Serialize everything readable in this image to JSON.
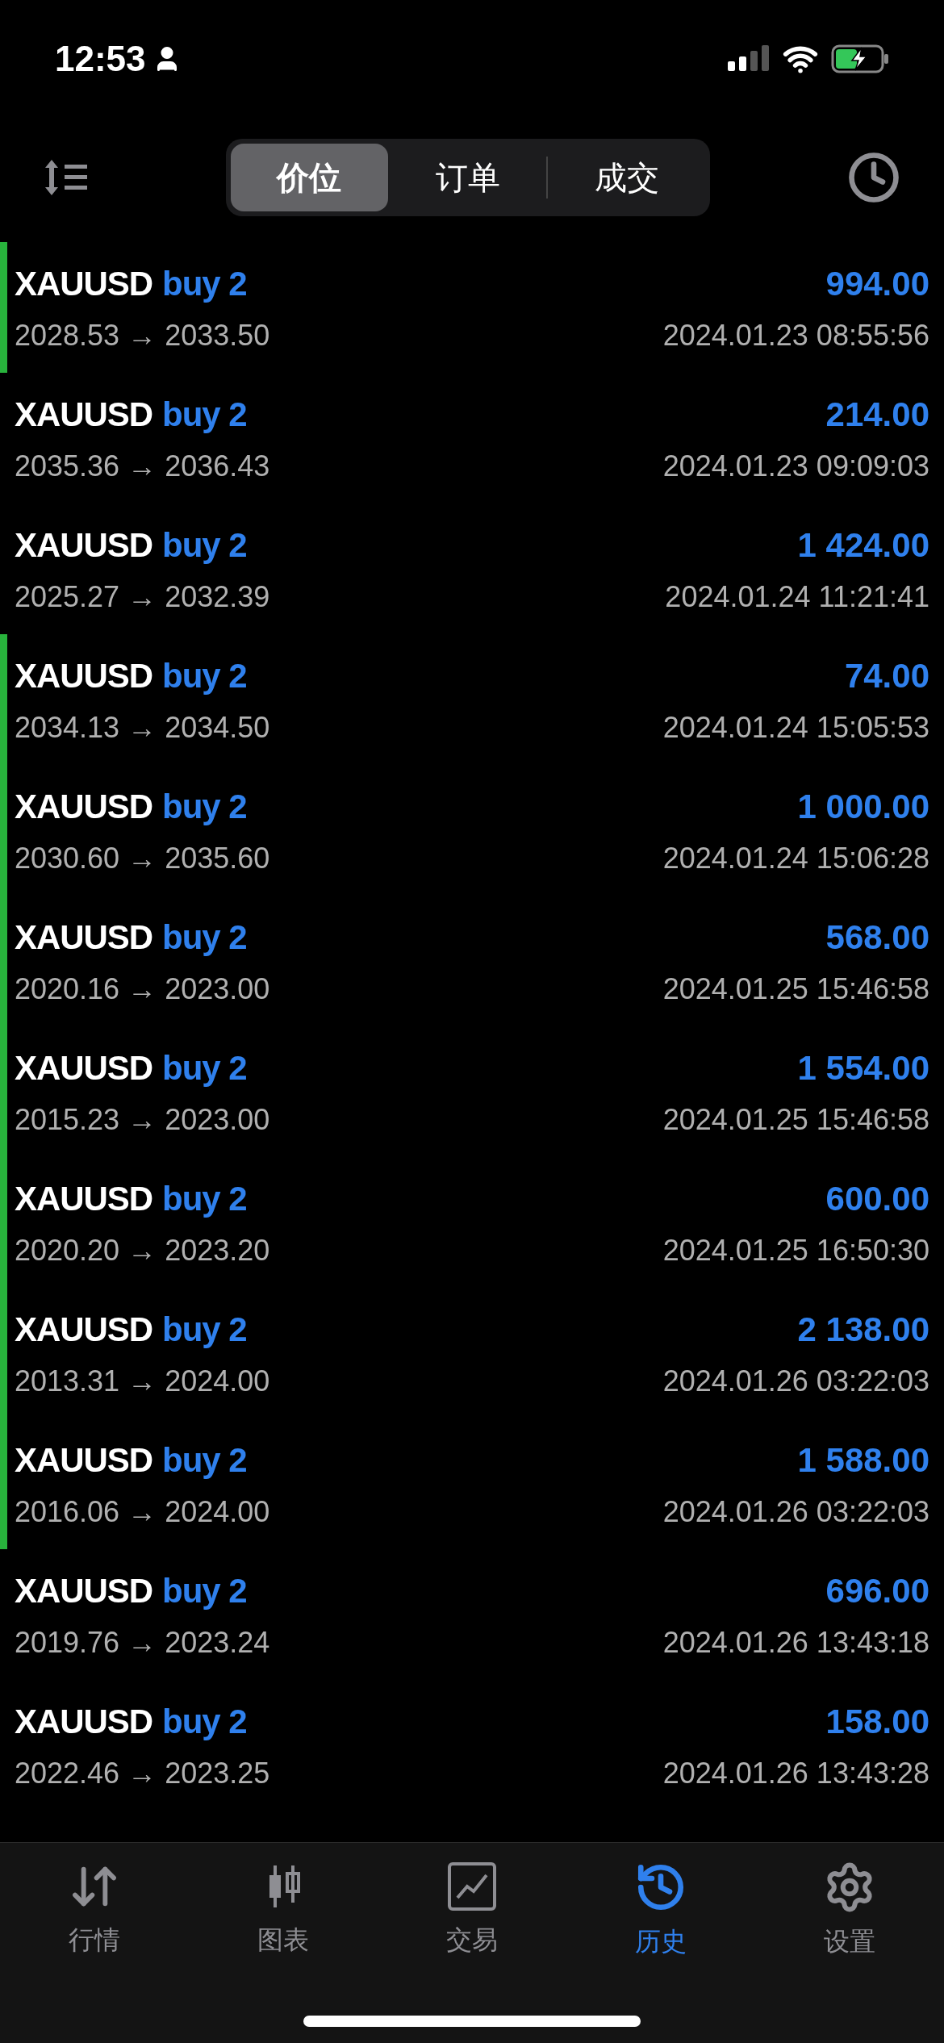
{
  "status_bar": {
    "time": "12:53"
  },
  "segments": [
    {
      "label": "价位",
      "selected": true
    },
    {
      "label": "订单",
      "selected": false
    },
    {
      "label": "成交",
      "selected": false
    }
  ],
  "deals": [
    {
      "symbol": "XAUUSD",
      "side": "buy 2",
      "profit": "994.00",
      "prices": "2028.53 → 2033.50",
      "time": "2024.01.23 08:55:56",
      "marked": true
    },
    {
      "symbol": "XAUUSD",
      "side": "buy 2",
      "profit": "214.00",
      "prices": "2035.36 → 2036.43",
      "time": "2024.01.23 09:09:03",
      "marked": false
    },
    {
      "symbol": "XAUUSD",
      "side": "buy 2",
      "profit": "1 424.00",
      "prices": "2025.27 → 2032.39",
      "time": "2024.01.24 11:21:41",
      "marked": false
    },
    {
      "symbol": "XAUUSD",
      "side": "buy 2",
      "profit": "74.00",
      "prices": "2034.13 → 2034.50",
      "time": "2024.01.24 15:05:53",
      "marked": true
    },
    {
      "symbol": "XAUUSD",
      "side": "buy 2",
      "profit": "1 000.00",
      "prices": "2030.60 → 2035.60",
      "time": "2024.01.24 15:06:28",
      "marked": true
    },
    {
      "symbol": "XAUUSD",
      "side": "buy 2",
      "profit": "568.00",
      "prices": "2020.16 → 2023.00",
      "time": "2024.01.25 15:46:58",
      "marked": true
    },
    {
      "symbol": "XAUUSD",
      "side": "buy 2",
      "profit": "1 554.00",
      "prices": "2015.23 → 2023.00",
      "time": "2024.01.25 15:46:58",
      "marked": true
    },
    {
      "symbol": "XAUUSD",
      "side": "buy 2",
      "profit": "600.00",
      "prices": "2020.20 → 2023.20",
      "time": "2024.01.25 16:50:30",
      "marked": true
    },
    {
      "symbol": "XAUUSD",
      "side": "buy 2",
      "profit": "2 138.00",
      "prices": "2013.31 → 2024.00",
      "time": "2024.01.26 03:22:03",
      "marked": true
    },
    {
      "symbol": "XAUUSD",
      "side": "buy 2",
      "profit": "1 588.00",
      "prices": "2016.06 → 2024.00",
      "time": "2024.01.26 03:22:03",
      "marked": true
    },
    {
      "symbol": "XAUUSD",
      "side": "buy 2",
      "profit": "696.00",
      "prices": "2019.76 → 2023.24",
      "time": "2024.01.26 13:43:18",
      "marked": false
    },
    {
      "symbol": "XAUUSD",
      "side": "buy 2",
      "profit": "158.00",
      "prices": "2022.46 → 2023.25",
      "time": "2024.01.26 13:43:28",
      "marked": false
    }
  ],
  "tab_bar": [
    {
      "kind": "quotes",
      "label": "行情",
      "selected": false
    },
    {
      "kind": "chart",
      "label": "图表",
      "selected": false
    },
    {
      "kind": "trade",
      "label": "交易",
      "selected": false
    },
    {
      "kind": "history",
      "label": "历史",
      "selected": true
    },
    {
      "kind": "settings",
      "label": "设置",
      "selected": false
    }
  ]
}
